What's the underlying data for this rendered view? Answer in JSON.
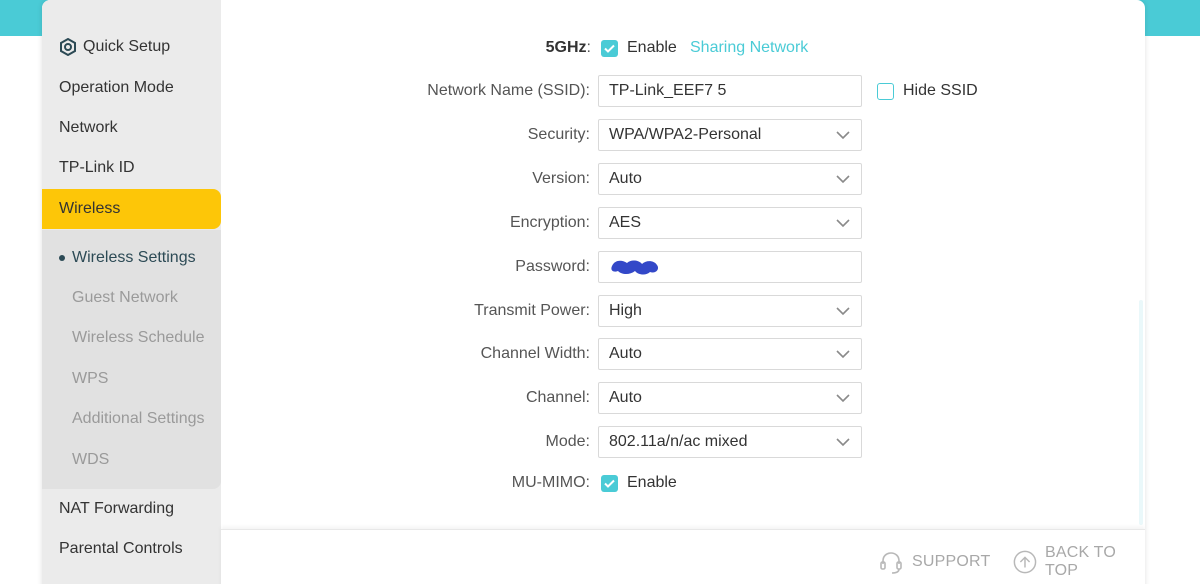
{
  "sidebar": {
    "quick_setup": "Quick Setup",
    "operation_mode": "Operation Mode",
    "network": "Network",
    "tplink_id": "TP-Link ID",
    "wireless": "Wireless",
    "submenu": {
      "wireless_settings": "Wireless Settings",
      "guest_network": "Guest Network",
      "wireless_schedule": "Wireless Schedule",
      "wps": "WPS",
      "additional_settings": "Additional Settings",
      "wds": "WDS"
    },
    "nat_forwarding": "NAT Forwarding",
    "parental_controls": "Parental Controls"
  },
  "form": {
    "band": {
      "label": "5GHz",
      "colon": ":",
      "enable_label": "Enable",
      "enabled": true,
      "sharing_link": "Sharing Network"
    },
    "ssid": {
      "label": "Network Name (SSID):",
      "value": "TP-Link_EEF7 5",
      "hide_label": "Hide SSID",
      "hide_checked": false
    },
    "security": {
      "label": "Security:",
      "value": "WPA/WPA2-Personal"
    },
    "version": {
      "label": "Version:",
      "value": "Auto"
    },
    "encryption": {
      "label": "Encryption:",
      "value": "AES"
    },
    "password": {
      "label": "Password:",
      "value_redacted": true
    },
    "transmit_power": {
      "label": "Transmit Power:",
      "value": "High"
    },
    "channel_width": {
      "label": "Channel Width:",
      "value": "Auto"
    },
    "channel": {
      "label": "Channel:",
      "value": "Auto"
    },
    "mode": {
      "label": "Mode:",
      "value": "802.11a/n/ac mixed"
    },
    "mu_mimo": {
      "label": "MU-MIMO:",
      "enable_label": "Enable",
      "enabled": true
    }
  },
  "footer": {
    "support": "SUPPORT",
    "back_to_top": "BACK TO TOP"
  },
  "colors": {
    "accent": "#4acbd6",
    "active_menu": "#fdc608",
    "redaction": "#3348c8"
  }
}
